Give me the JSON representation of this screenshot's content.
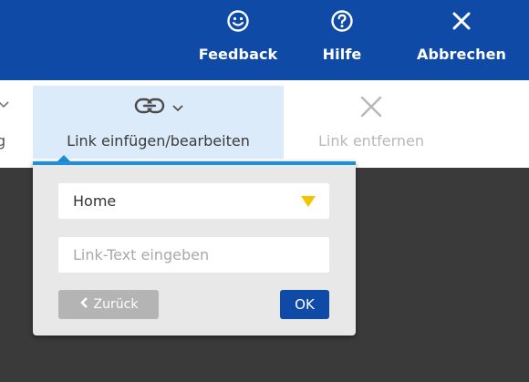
{
  "header": {
    "actions": [
      {
        "label": "Feedback",
        "icon": "smiley-icon"
      },
      {
        "label": "Hilfe",
        "icon": "help-icon"
      },
      {
        "label": "Abbrechen",
        "icon": "close-icon"
      }
    ]
  },
  "toolbar": {
    "partial_label": "g",
    "link_button": {
      "label": "Link einfügen/bearbeiten",
      "icon": "link-icon"
    },
    "unlink_button": {
      "label": "Link entfernen",
      "icon": "close-icon",
      "disabled": true
    }
  },
  "link_popup": {
    "page_select": {
      "value": "Home"
    },
    "link_text": {
      "value": "",
      "placeholder": "Link-Text eingeben"
    },
    "back_button": {
      "label": "Zurück"
    },
    "ok_button": {
      "label": "OK"
    }
  },
  "colors": {
    "header_bg": "#0e4aa6",
    "accent": "#1d8fe0",
    "dropdown_arrow": "#f5c400",
    "active_tool_bg": "#dcebfa"
  }
}
